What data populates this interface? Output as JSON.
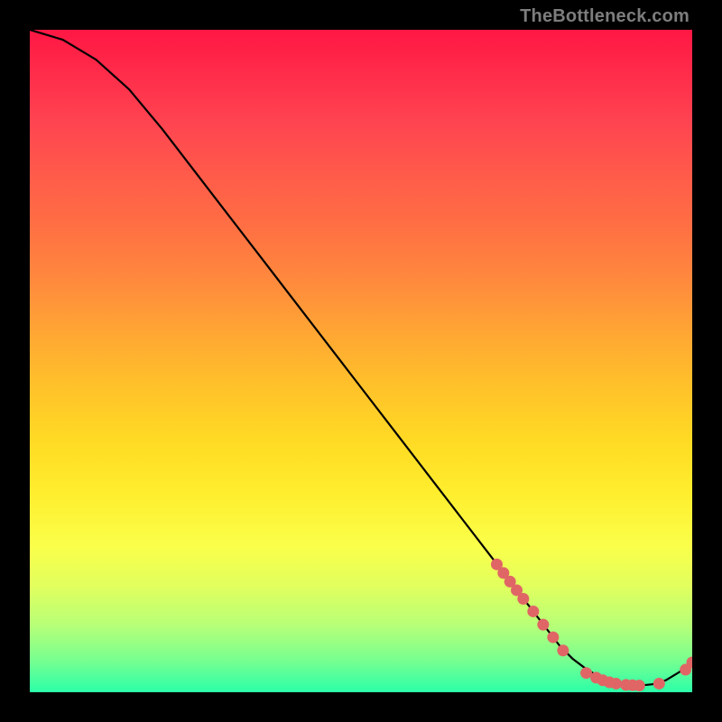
{
  "watermark": "TheBottleneck.com",
  "chart_data": {
    "type": "line",
    "title": "",
    "xlabel": "",
    "ylabel": "",
    "xlim": [
      0,
      100
    ],
    "ylim": [
      0,
      100
    ],
    "series": [
      {
        "name": "curve",
        "x": [
          0,
          5,
          10,
          15,
          20,
          25,
          30,
          35,
          40,
          45,
          50,
          55,
          60,
          65,
          70,
          75,
          80,
          82,
          84,
          86,
          88,
          90,
          92,
          94,
          96,
          98,
          100
        ],
        "y": [
          100,
          98.5,
          95.5,
          91,
          85,
          78.5,
          72,
          65.5,
          59,
          52.5,
          46,
          39.5,
          33,
          26.5,
          20,
          13.5,
          7,
          5,
          3.5,
          2.3,
          1.5,
          1.1,
          1.0,
          1.2,
          1.8,
          3.0,
          4.5
        ]
      }
    ],
    "markers": {
      "name": "dots",
      "color": "#e06666",
      "x": [
        70.5,
        71.5,
        72.5,
        73.5,
        74.5,
        76.0,
        77.5,
        79.0,
        80.5,
        84.0,
        85.5,
        86.5,
        87.5,
        88.5,
        90.0,
        91.0,
        92.0,
        95.0,
        99.0,
        100.0
      ],
      "y": [
        19.3,
        18.0,
        16.7,
        15.4,
        14.1,
        12.2,
        10.2,
        8.3,
        6.3,
        2.9,
        2.2,
        1.8,
        1.5,
        1.3,
        1.1,
        1.05,
        1.0,
        1.3,
        3.4,
        4.5
      ]
    }
  }
}
